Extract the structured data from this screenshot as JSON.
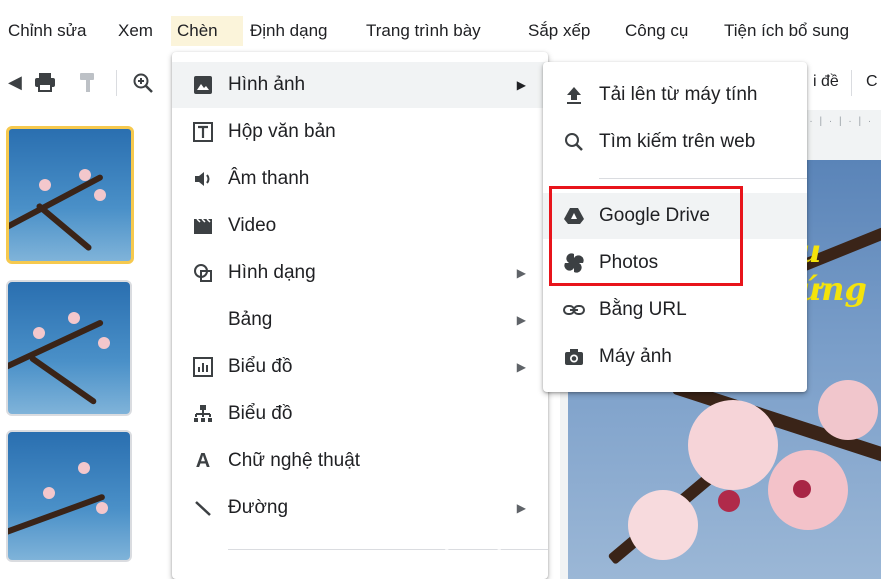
{
  "menubar": {
    "items": [
      {
        "label": "Chỉnh sửa",
        "active": false
      },
      {
        "label": "Xem",
        "active": false
      },
      {
        "label": "Chèn",
        "active": true
      },
      {
        "label": "Định dạng",
        "active": false
      },
      {
        "label": "Trang trình bày",
        "active": false
      },
      {
        "label": "Sắp xếp",
        "active": false
      },
      {
        "label": "Công cụ",
        "active": false
      },
      {
        "label": "Tiện ích bổ sung",
        "active": false
      }
    ]
  },
  "toolbar": {
    "right_labels": [
      "i đề",
      "C"
    ]
  },
  "slide": {
    "title_fragment": "u ứng"
  },
  "insert_menu": {
    "items": [
      {
        "label": "Hình ảnh",
        "icon": "image-icon",
        "submenu": true
      },
      {
        "label": "Hộp văn bản",
        "icon": "text-box-icon",
        "submenu": false
      },
      {
        "label": "Âm thanh",
        "icon": "audio-icon",
        "submenu": false
      },
      {
        "label": "Video",
        "icon": "video-icon",
        "submenu": false
      },
      {
        "label": "Hình dạng",
        "icon": "shape-icon",
        "submenu": true
      },
      {
        "label": "Bảng",
        "icon": "",
        "submenu": true
      },
      {
        "label": "Biểu đồ",
        "icon": "chart-icon",
        "submenu": true
      },
      {
        "label": "Biểu đồ",
        "icon": "diagram-icon",
        "submenu": false
      },
      {
        "label": "Chữ nghệ thuật",
        "icon": "word-art-icon",
        "submenu": false
      },
      {
        "label": "Đường",
        "icon": "line-icon",
        "submenu": true
      }
    ]
  },
  "image_submenu": {
    "items": [
      {
        "label": "Tải lên từ máy tính",
        "icon": "upload-icon"
      },
      {
        "label": "Tìm kiếm trên web",
        "icon": "search-icon"
      },
      {
        "label": "Google Drive",
        "icon": "google-drive-icon"
      },
      {
        "label": "Photos",
        "icon": "photos-icon"
      },
      {
        "label": "Bằng URL",
        "icon": "link-icon"
      },
      {
        "label": "Máy ảnh",
        "icon": "camera-icon"
      }
    ]
  },
  "colors": {
    "highlight_box": "#e8141b",
    "active_menu_bg": "#fbf4da",
    "slide_title": "#f4e30b"
  }
}
